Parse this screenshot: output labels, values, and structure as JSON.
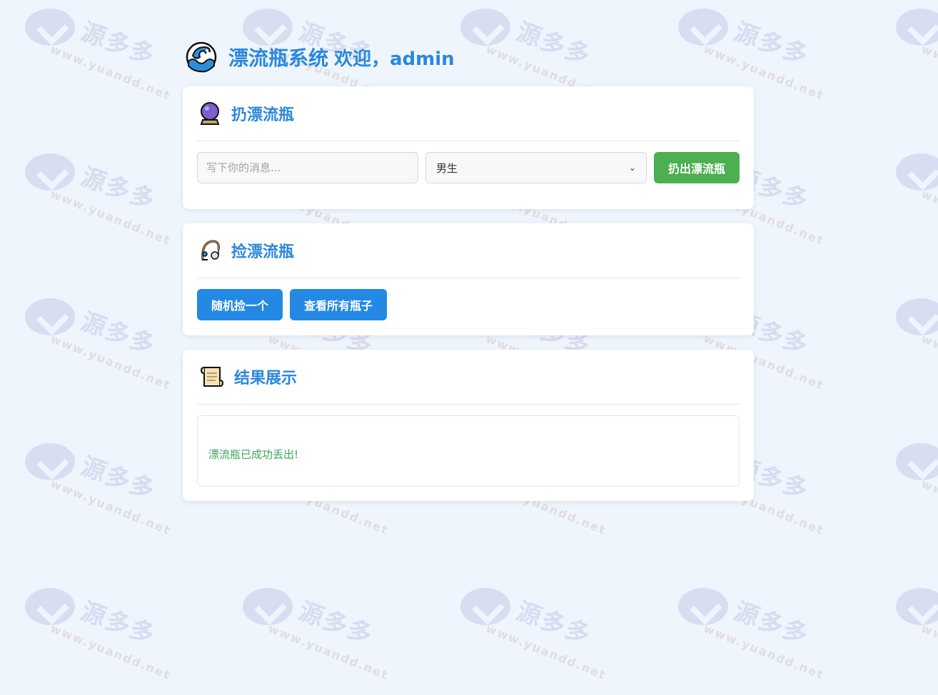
{
  "header": {
    "title": "漂流瓶系统",
    "welcome": "欢迎，admin",
    "icon": "wave-icon"
  },
  "throw_section": {
    "title": "扔漂流瓶",
    "icon": "crystal-ball-icon",
    "message_placeholder": "写下你的消息...",
    "gender_selected": "男生",
    "throw_button": "扔出漂流瓶"
  },
  "pick_section": {
    "title": "捡漂流瓶",
    "icon": "fishing-pole-icon",
    "random_button": "随机捡一个",
    "view_all_button": "查看所有瓶子"
  },
  "result_section": {
    "title": "结果展示",
    "icon": "scroll-icon",
    "message": "漂流瓶已成功丢出!"
  },
  "watermark": {
    "brand": "源多多",
    "url": "www.yuandd.net"
  },
  "colors": {
    "accent": "#2b87dc",
    "success": "#4caf50",
    "primary_button": "#2389e5",
    "page_background": "#eef5fd"
  }
}
